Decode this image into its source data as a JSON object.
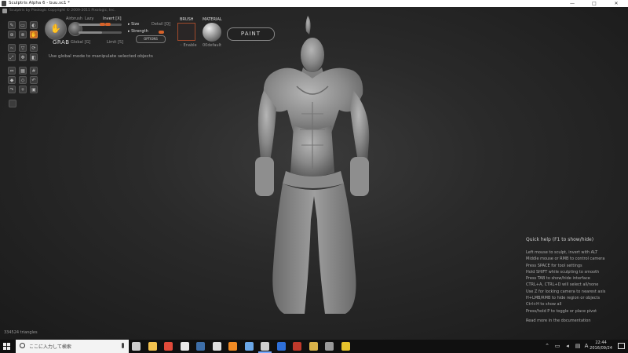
{
  "window": {
    "title": "Sculptris Alpha 6 - buu.sc1 *",
    "minimize": "—",
    "maximize": "□",
    "close": "✕"
  },
  "header": {
    "copyright": "Sculptris by Pixologic   Copyright © 2009-2011 Pixologic, Inc."
  },
  "toolbar": {
    "tool_name": "GRAB",
    "tool_icon": "hand-icon",
    "labels": {
      "airbrush": "Airbrush",
      "lazy": "Lazy",
      "invert": "Invert [X]",
      "size": "Size",
      "strength": "Strength",
      "detail": "Detail [Q]",
      "global": "Global [G]",
      "limit": "Limit [S]",
      "options": "OPTIONS"
    },
    "size_value": 0.55,
    "strength_value": 0.55,
    "accent_color": "#d6622a"
  },
  "brush": {
    "heading": "BRUSH",
    "enable": "Enable"
  },
  "material": {
    "heading": "MATERIAL",
    "name": "00default"
  },
  "paint_button": "PAINT",
  "hint": "Use global mode to manipulate selected objects",
  "left_tools": [
    "draw-icon",
    "flatten-icon",
    "crease-icon",
    "inflate-icon",
    "pinch-icon",
    "grab-icon",
    "smooth-icon",
    "reduce-icon",
    "rotate-icon",
    "scale-icon",
    "translate-icon",
    "mask-icon",
    "mirror-icon",
    "wireframe-icon",
    "grid-icon",
    "subdivide-icon",
    "reduce-all-icon",
    "undo-icon",
    "redo-icon",
    "new-icon",
    "open-icon"
  ],
  "help": {
    "title": "Quick help (F1 to show/hide)",
    "lines": [
      "Left mouse to sculpt, invert with ALT",
      "Middle mouse or RMB to control camera",
      "Press SPACE for tool settings",
      "Hold SHIFT while sculpting to smooth",
      "Press TAB to show/hide interface",
      "CTRL+A, CTRL+D will select all/none",
      "Use Z for locking camera to nearest axis",
      "H+LMB/RMB to hide region or objects",
      "Ctrl+H to show all",
      "Press/hold P to toggle or place pivot"
    ],
    "footer": "Read more in the documentation"
  },
  "status": {
    "triangles": "334524 triangles"
  },
  "taskbar": {
    "search_placeholder": "ここに入力して検索",
    "clock_time": "22:44",
    "clock_date": "2016/09/24",
    "ime": "A",
    "tray_icons": [
      "chevron-up-icon",
      "network-icon",
      "volume-icon",
      "keyboard-icon"
    ],
    "apps": [
      {
        "name": "task-view-icon",
        "color": "#cccccc"
      },
      {
        "name": "file-explorer-icon",
        "color": "#f2c14e"
      },
      {
        "name": "chrome-icon",
        "color": "#e04a3a"
      },
      {
        "name": "store-icon",
        "color": "#e8e8e8"
      },
      {
        "name": "photoshop-icon",
        "color": "#3d6ea8"
      },
      {
        "name": "notes-icon",
        "color": "#dddddd"
      },
      {
        "name": "blender-icon",
        "color": "#f08a24"
      },
      {
        "name": "screen-icon",
        "color": "#6aa7e8"
      },
      {
        "name": "sculptris-icon",
        "color": "#cfcfcf"
      },
      {
        "name": "app-blue-icon",
        "color": "#2e6fd8"
      },
      {
        "name": "app-red-icon",
        "color": "#c0392b"
      },
      {
        "name": "app-star-icon",
        "color": "#d8b24a"
      },
      {
        "name": "app-gun-icon",
        "color": "#999999"
      },
      {
        "name": "app-spark-icon",
        "color": "#e5c22c"
      }
    ]
  }
}
